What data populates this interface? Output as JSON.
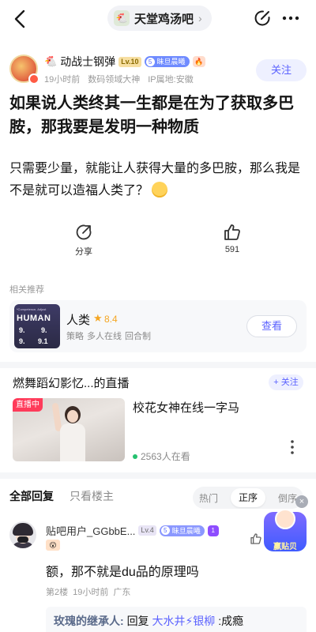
{
  "topbar": {
    "forum_name": "天堂鸡汤吧",
    "forum_chevron": "›",
    "back_icon": "chevron-left-icon",
    "edit_icon": "edit-icon",
    "more_icon": "more-dots-icon"
  },
  "author": {
    "name": "动战士钢弹",
    "emoji": "🐔",
    "level": "Lv.10",
    "member_level": "5",
    "member_label": "昧旦晨曦",
    "fire_badge": "🔥",
    "time": "19小时前",
    "title": "数码领域大神",
    "location": "IP属地:安徽",
    "follow_label": "关注"
  },
  "post": {
    "title": "如果说人类终其一生都是在为了获取多巴胺，那我要是发明一种物质",
    "body": "只需要少量，就能让人获得大量的多巴胺，那么我是不是就可以造福人类了？"
  },
  "actions": {
    "share_label": "分享",
    "like_count": "591"
  },
  "related": {
    "section_title": "相关推荐",
    "thumb_tagline": "*Competence, Adjust",
    "thumb_title": "HUMAN",
    "thumb_score_a": "9.",
    "thumb_score_b": "9.",
    "thumb_score_c": "9.",
    "thumb_score_d": "9.1",
    "name": "人类",
    "score": "8.4",
    "tags": [
      "策略",
      "多人在线",
      "回合制"
    ],
    "button_label": "查看"
  },
  "live": {
    "heading": "燃舞蹈幻影忆...的直播",
    "follow_label": "+ 关注",
    "tag": "直播中",
    "title": "校花女神在线一字马",
    "viewers": "2563人在看"
  },
  "replies": {
    "tab_all": "全部回复",
    "tab_op": "只看楼主",
    "sort_hot": "热门",
    "sort_asc": "正序",
    "sort_desc": "倒序",
    "close_glyph": "×"
  },
  "comment": {
    "user": "贴吧用户_GGbbE...",
    "level": "Lv.4",
    "member_level": "5",
    "member_label": "昧旦晨曦",
    "purple_badge": "1",
    "small_badge": "😮",
    "text": "额，那不就是du品的原理吗",
    "floor": "第2楼",
    "time": "19小时前",
    "location": "广东",
    "promo_label": "赢贴贝"
  },
  "sub_reply": {
    "user": "玫瑰的继承人:",
    "prefix": "回复",
    "target": "大水井⚡银柳",
    "text": ":成瘾"
  }
}
